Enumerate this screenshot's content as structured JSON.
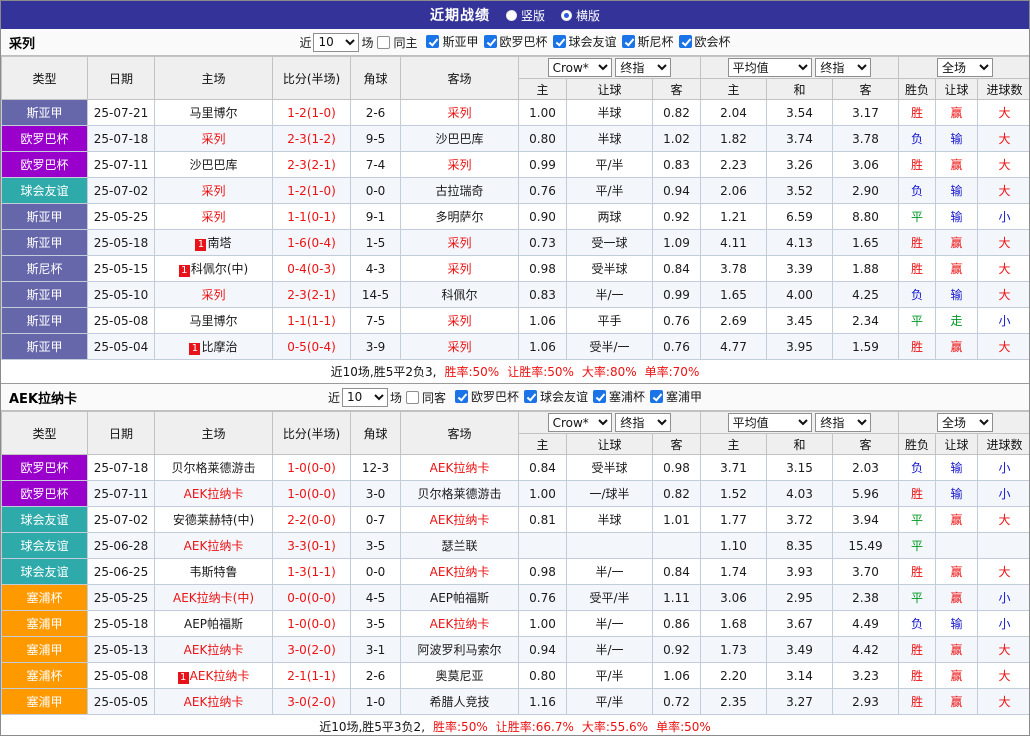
{
  "titlebar": {
    "title": "近期战绩",
    "layout_options": [
      {
        "label": "竖版",
        "selected": false
      },
      {
        "label": "横版",
        "selected": true
      }
    ]
  },
  "table_header": {
    "left_cols": [
      "类型",
      "日期",
      "主场",
      "比分(半场)",
      "角球",
      "客场"
    ],
    "odds_selects": [
      "Crow*",
      "终指"
    ],
    "avg_selects": [
      "平均值",
      "终指"
    ],
    "full_select": "全场",
    "sub_cols": [
      "主",
      "让球",
      "客",
      "主",
      "和",
      "客",
      "胜负",
      "让球",
      "进球数"
    ]
  },
  "league_colors": {
    "斯亚甲": "#6666AA",
    "欧罗巴杯": "#9900CC",
    "球会友谊": "#2FAAAA",
    "斯尼杯": "#6666AA",
    "塞浦杯": "#FF9900",
    "塞浦甲": "#FF9900"
  },
  "result_colors": {
    "胜": "red",
    "负": "blue",
    "平": "green",
    "赢": "red",
    "输": "blue",
    "走": "green",
    "大": "red",
    "小": "blue"
  },
  "sections": [
    {
      "team": "采列",
      "filters": {
        "near_label": "近",
        "count": "10",
        "games_label": "场",
        "venue": {
          "label": "同主",
          "checked": false
        },
        "leagues": [
          {
            "label": "斯亚甲",
            "checked": true
          },
          {
            "label": "欧罗巴杯",
            "checked": true
          },
          {
            "label": "球会友谊",
            "checked": true
          },
          {
            "label": "斯尼杯",
            "checked": true
          },
          {
            "label": "欧会杯",
            "checked": true
          }
        ]
      },
      "rows": [
        {
          "league": "斯亚甲",
          "date": "25-07-21",
          "home": {
            "name": "马里博尔",
            "red": false,
            "badge": ""
          },
          "score": "1-2(1-0)",
          "corners": "2-6",
          "away": {
            "name": "采列",
            "red": true,
            "badge": ""
          },
          "odds": [
            "1.00",
            "半球",
            "0.82"
          ],
          "avg": [
            "2.04",
            "3.54",
            "3.17"
          ],
          "results": [
            "胜",
            "赢",
            "大"
          ]
        },
        {
          "league": "欧罗巴杯",
          "date": "25-07-18",
          "home": {
            "name": "采列",
            "red": true,
            "badge": ""
          },
          "score": "2-3(1-2)",
          "corners": "9-5",
          "away": {
            "name": "沙巴巴库",
            "red": false,
            "badge": ""
          },
          "odds": [
            "0.80",
            "半球",
            "1.02"
          ],
          "avg": [
            "1.82",
            "3.74",
            "3.78"
          ],
          "results": [
            "负",
            "输",
            "大"
          ]
        },
        {
          "league": "欧罗巴杯",
          "date": "25-07-11",
          "home": {
            "name": "沙巴巴库",
            "red": false,
            "badge": ""
          },
          "score": "2-3(2-1)",
          "corners": "7-4",
          "away": {
            "name": "采列",
            "red": true,
            "badge": ""
          },
          "odds": [
            "0.99",
            "平/半",
            "0.83"
          ],
          "avg": [
            "2.23",
            "3.26",
            "3.06"
          ],
          "results": [
            "胜",
            "赢",
            "大"
          ]
        },
        {
          "league": "球会友谊",
          "date": "25-07-02",
          "home": {
            "name": "采列",
            "red": true,
            "badge": ""
          },
          "score": "1-2(1-0)",
          "corners": "0-0",
          "away": {
            "name": "古拉瑞奇",
            "red": false,
            "badge": ""
          },
          "odds": [
            "0.76",
            "平/半",
            "0.94"
          ],
          "avg": [
            "2.06",
            "3.52",
            "2.90"
          ],
          "results": [
            "负",
            "输",
            "大"
          ]
        },
        {
          "league": "斯亚甲",
          "date": "25-05-25",
          "home": {
            "name": "采列",
            "red": true,
            "badge": ""
          },
          "score": "1-1(0-1)",
          "corners": "9-1",
          "away": {
            "name": "多明萨尔",
            "red": false,
            "badge": ""
          },
          "odds": [
            "0.90",
            "两球",
            "0.92"
          ],
          "avg": [
            "1.21",
            "6.59",
            "8.80"
          ],
          "results": [
            "平",
            "输",
            "小"
          ]
        },
        {
          "league": "斯亚甲",
          "date": "25-05-18",
          "home": {
            "name": "南塔",
            "red": false,
            "badge": "1"
          },
          "score": "1-6(0-4)",
          "corners": "1-5",
          "away": {
            "name": "采列",
            "red": true,
            "badge": ""
          },
          "odds": [
            "0.73",
            "受一球",
            "1.09"
          ],
          "avg": [
            "4.11",
            "4.13",
            "1.65"
          ],
          "results": [
            "胜",
            "赢",
            "大"
          ]
        },
        {
          "league": "斯尼杯",
          "date": "25-05-15",
          "home": {
            "name": "科佩尔(中)",
            "red": false,
            "badge": "1"
          },
          "score": "0-4(0-3)",
          "corners": "4-3",
          "away": {
            "name": "采列",
            "red": true,
            "badge": ""
          },
          "odds": [
            "0.98",
            "受半球",
            "0.84"
          ],
          "avg": [
            "3.78",
            "3.39",
            "1.88"
          ],
          "results": [
            "胜",
            "赢",
            "大"
          ]
        },
        {
          "league": "斯亚甲",
          "date": "25-05-10",
          "home": {
            "name": "采列",
            "red": true,
            "badge": ""
          },
          "score": "2-3(2-1)",
          "corners": "14-5",
          "away": {
            "name": "科佩尔",
            "red": false,
            "badge": ""
          },
          "odds": [
            "0.83",
            "半/一",
            "0.99"
          ],
          "avg": [
            "1.65",
            "4.00",
            "4.25"
          ],
          "results": [
            "负",
            "输",
            "大"
          ]
        },
        {
          "league": "斯亚甲",
          "date": "25-05-08",
          "home": {
            "name": "马里博尔",
            "red": false,
            "badge": ""
          },
          "score": "1-1(1-1)",
          "corners": "7-5",
          "away": {
            "name": "采列",
            "red": true,
            "badge": ""
          },
          "odds": [
            "1.06",
            "平手",
            "0.76"
          ],
          "avg": [
            "2.69",
            "3.45",
            "2.34"
          ],
          "results": [
            "平",
            "走",
            "小"
          ]
        },
        {
          "league": "斯亚甲",
          "date": "25-05-04",
          "home": {
            "name": "比摩治",
            "red": false,
            "badge": "1"
          },
          "score": "0-5(0-4)",
          "corners": "3-9",
          "away": {
            "name": "采列",
            "red": true,
            "badge": ""
          },
          "odds": [
            "1.06",
            "受半/一",
            "0.76"
          ],
          "avg": [
            "4.77",
            "3.95",
            "1.59"
          ],
          "results": [
            "胜",
            "赢",
            "大"
          ]
        }
      ],
      "summary": {
        "record": "近10场,胜5平2负3,",
        "stats": [
          {
            "label": "胜率:",
            "value": "50%"
          },
          {
            "label": "让胜率:",
            "value": "50%"
          },
          {
            "label": "大率:",
            "value": "80%"
          },
          {
            "label": "单率:",
            "value": "70%"
          }
        ]
      }
    },
    {
      "team": "AEK拉纳卡",
      "filters": {
        "near_label": "近",
        "count": "10",
        "games_label": "场",
        "venue": {
          "label": "同客",
          "checked": false
        },
        "leagues": [
          {
            "label": "欧罗巴杯",
            "checked": true
          },
          {
            "label": "球会友谊",
            "checked": true
          },
          {
            "label": "塞浦杯",
            "checked": true
          },
          {
            "label": "塞浦甲",
            "checked": true
          }
        ]
      },
      "rows": [
        {
          "league": "欧罗巴杯",
          "date": "25-07-18",
          "home": {
            "name": "贝尔格莱德游击",
            "red": false,
            "badge": ""
          },
          "score": "1-0(0-0)",
          "corners": "12-3",
          "away": {
            "name": "AEK拉纳卡",
            "red": true,
            "badge": ""
          },
          "odds": [
            "0.84",
            "受半球",
            "0.98"
          ],
          "avg": [
            "3.71",
            "3.15",
            "2.03"
          ],
          "results": [
            "负",
            "输",
            "小"
          ]
        },
        {
          "league": "欧罗巴杯",
          "date": "25-07-11",
          "home": {
            "name": "AEK拉纳卡",
            "red": true,
            "badge": ""
          },
          "score": "1-0(0-0)",
          "corners": "3-0",
          "away": {
            "name": "贝尔格莱德游击",
            "red": false,
            "badge": ""
          },
          "odds": [
            "1.00",
            "一/球半",
            "0.82"
          ],
          "avg": [
            "1.52",
            "4.03",
            "5.96"
          ],
          "results": [
            "胜",
            "输",
            "小"
          ]
        },
        {
          "league": "球会友谊",
          "date": "25-07-02",
          "home": {
            "name": "安德莱赫特(中)",
            "red": false,
            "badge": ""
          },
          "score": "2-2(0-0)",
          "corners": "0-7",
          "away": {
            "name": "AEK拉纳卡",
            "red": true,
            "badge": ""
          },
          "odds": [
            "0.81",
            "半球",
            "1.01"
          ],
          "avg": [
            "1.77",
            "3.72",
            "3.94"
          ],
          "results": [
            "平",
            "赢",
            "大"
          ]
        },
        {
          "league": "球会友谊",
          "date": "25-06-28",
          "home": {
            "name": "AEK拉纳卡",
            "red": true,
            "badge": ""
          },
          "score": "3-3(0-1)",
          "corners": "3-5",
          "away": {
            "name": "瑟兰联",
            "red": false,
            "badge": ""
          },
          "odds": [
            "",
            "",
            ""
          ],
          "avg": [
            "1.10",
            "8.35",
            "15.49"
          ],
          "results": [
            "平",
            "",
            ""
          ]
        },
        {
          "league": "球会友谊",
          "date": "25-06-25",
          "home": {
            "name": "韦斯特鲁",
            "red": false,
            "badge": ""
          },
          "score": "1-3(1-1)",
          "corners": "0-0",
          "away": {
            "name": "AEK拉纳卡",
            "red": true,
            "badge": ""
          },
          "odds": [
            "0.98",
            "半/一",
            "0.84"
          ],
          "avg": [
            "1.74",
            "3.93",
            "3.70"
          ],
          "results": [
            "胜",
            "赢",
            "大"
          ]
        },
        {
          "league": "塞浦杯",
          "date": "25-05-25",
          "home": {
            "name": "AEK拉纳卡(中)",
            "red": true,
            "badge": ""
          },
          "score": "0-0(0-0)",
          "corners": "4-5",
          "away": {
            "name": "AEP帕福斯",
            "red": false,
            "badge": ""
          },
          "odds": [
            "0.76",
            "受平/半",
            "1.11"
          ],
          "avg": [
            "3.06",
            "2.95",
            "2.38"
          ],
          "results": [
            "平",
            "赢",
            "小"
          ]
        },
        {
          "league": "塞浦甲",
          "date": "25-05-18",
          "home": {
            "name": "AEP帕福斯",
            "red": false,
            "badge": ""
          },
          "score": "1-0(0-0)",
          "corners": "3-5",
          "away": {
            "name": "AEK拉纳卡",
            "red": true,
            "badge": ""
          },
          "odds": [
            "1.00",
            "半/一",
            "0.86"
          ],
          "avg": [
            "1.68",
            "3.67",
            "4.49"
          ],
          "results": [
            "负",
            "输",
            "小"
          ]
        },
        {
          "league": "塞浦甲",
          "date": "25-05-13",
          "home": {
            "name": "AEK拉纳卡",
            "red": true,
            "badge": ""
          },
          "score": "3-0(2-0)",
          "corners": "3-1",
          "away": {
            "name": "阿波罗利马索尔",
            "red": false,
            "badge": ""
          },
          "odds": [
            "0.94",
            "半/一",
            "0.92"
          ],
          "avg": [
            "1.73",
            "3.49",
            "4.42"
          ],
          "results": [
            "胜",
            "赢",
            "大"
          ]
        },
        {
          "league": "塞浦杯",
          "date": "25-05-08",
          "home": {
            "name": "AEK拉纳卡",
            "red": true,
            "badge": "1"
          },
          "score": "2-1(1-1)",
          "corners": "2-6",
          "away": {
            "name": "奥莫尼亚",
            "red": false,
            "badge": ""
          },
          "odds": [
            "0.80",
            "平/半",
            "1.06"
          ],
          "avg": [
            "2.20",
            "3.14",
            "3.23"
          ],
          "results": [
            "胜",
            "赢",
            "大"
          ]
        },
        {
          "league": "塞浦甲",
          "date": "25-05-05",
          "home": {
            "name": "AEK拉纳卡",
            "red": true,
            "badge": ""
          },
          "score": "3-0(2-0)",
          "corners": "1-0",
          "away": {
            "name": "希腊人竞技",
            "red": false,
            "badge": ""
          },
          "odds": [
            "1.16",
            "平/半",
            "0.72"
          ],
          "avg": [
            "2.35",
            "3.27",
            "2.93"
          ],
          "results": [
            "胜",
            "赢",
            "大"
          ]
        }
      ],
      "summary": {
        "record": "近10场,胜5平3负2,",
        "stats": [
          {
            "label": "胜率:",
            "value": "50%"
          },
          {
            "label": "让胜率:",
            "value": "66.7%"
          },
          {
            "label": "大率:",
            "value": "55.6%"
          },
          {
            "label": "单率:",
            "value": "50%"
          }
        ]
      }
    }
  ]
}
